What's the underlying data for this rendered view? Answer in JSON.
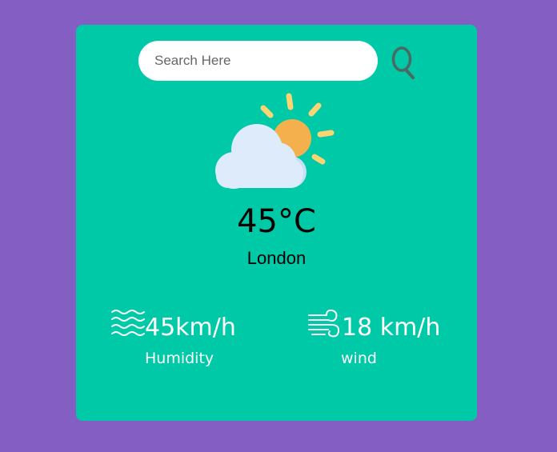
{
  "search": {
    "placeholder": "Search Here",
    "value": "",
    "button_icon": "search-icon"
  },
  "weather": {
    "icon": "partly-cloudy-icon",
    "temperature": "45°C",
    "city": "London"
  },
  "details": {
    "humidity": {
      "icon": "humidity-waves-icon",
      "value": "45km/h",
      "label": "Humidity"
    },
    "wind": {
      "icon": "wind-icon",
      "value": "18 km/h",
      "label": "wind"
    }
  },
  "colors": {
    "page_background": "#845ec2",
    "card_background": "#00c9a7",
    "text_dark": "#000000",
    "text_light": "#ffffff",
    "sun": "#f5b04e",
    "sun_rays": "#fdd472",
    "cloud": "#dbeafe"
  }
}
